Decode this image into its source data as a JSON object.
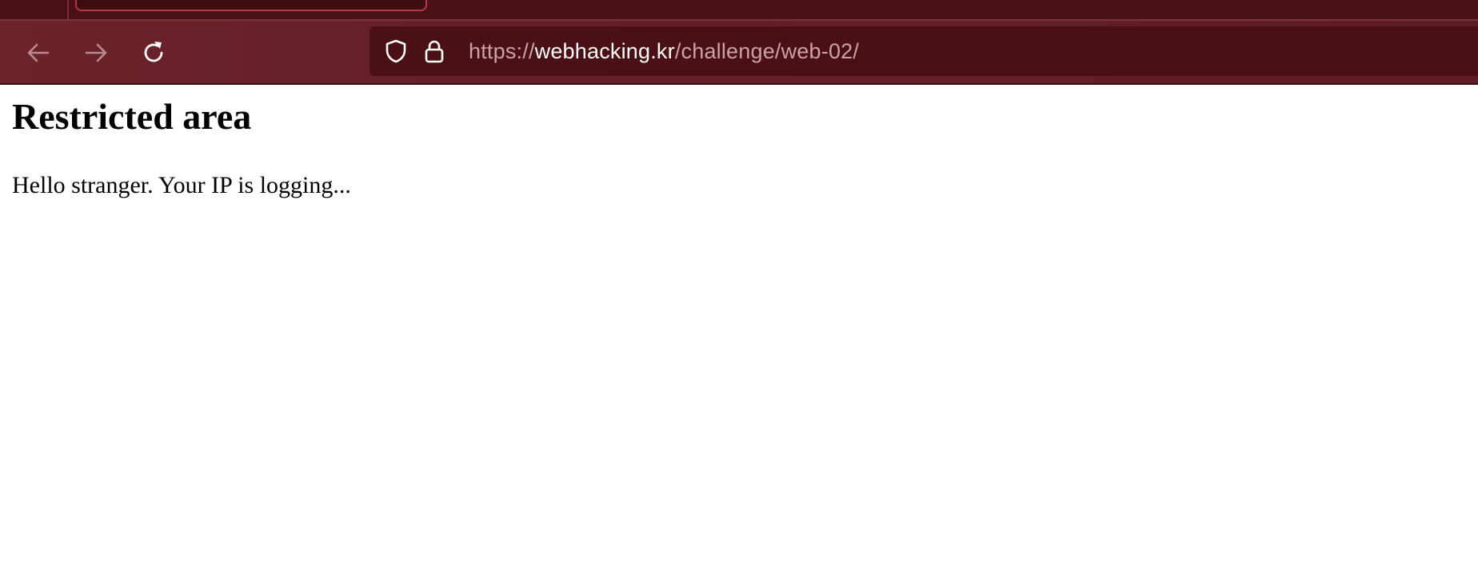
{
  "browser": {
    "url": {
      "scheme": "https://",
      "host": "webhacking.kr",
      "path": "/challenge/web-02/"
    },
    "icons": {
      "back": "arrow-left-icon",
      "forward": "arrow-right-icon",
      "reload": "reload-icon",
      "tracking_protection": "shield-icon",
      "connection_secure": "lock-icon"
    },
    "colors": {
      "toolbar": "#6b2229",
      "tab_strip": "#4b1117",
      "url_bar": "#4a1016",
      "url_host": "#ffffff",
      "url_dim": "#c9a3a7"
    }
  },
  "page": {
    "title": "Restricted area",
    "message": "Hello stranger. Your IP is logging..."
  }
}
